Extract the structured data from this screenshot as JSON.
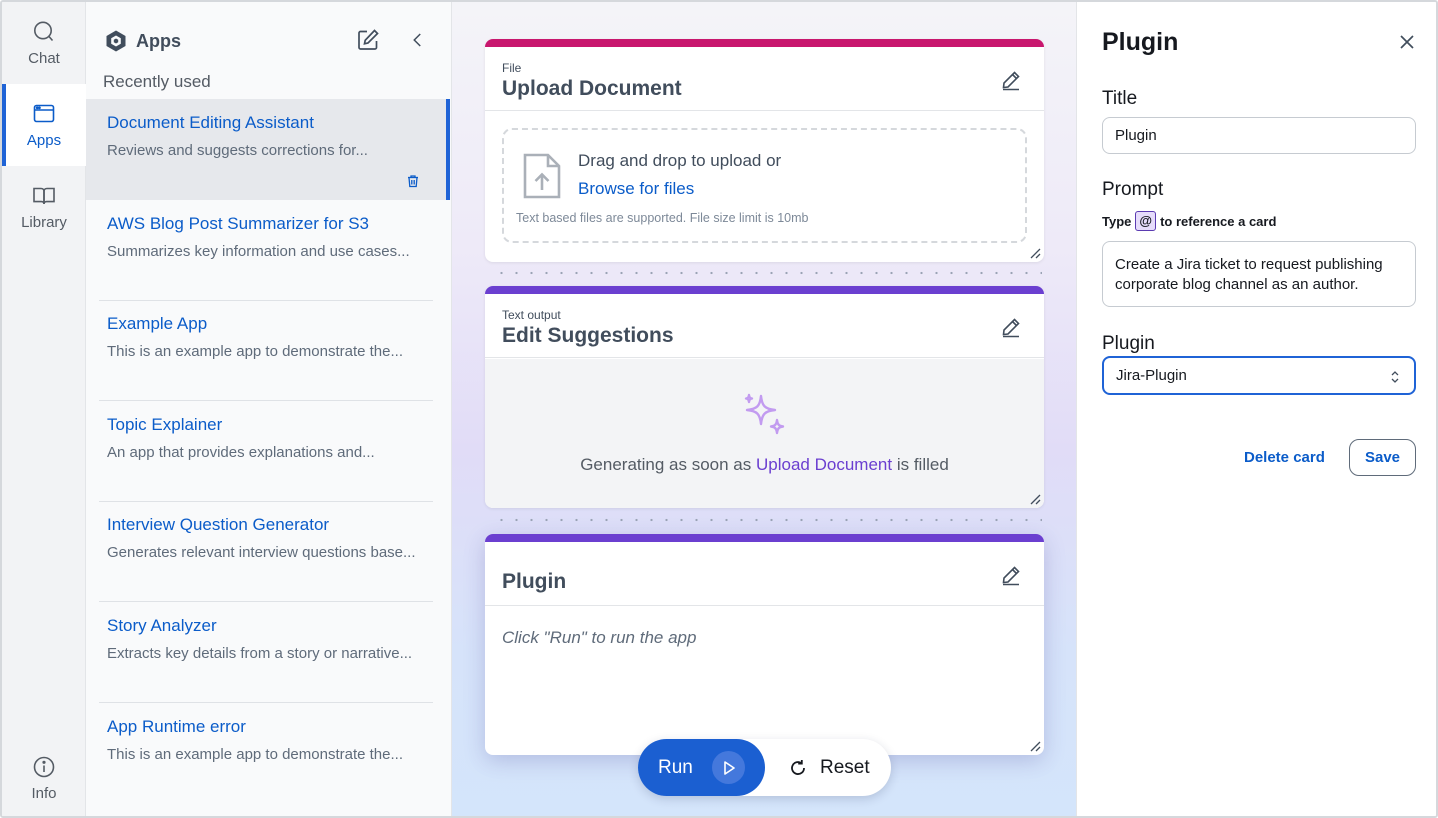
{
  "rail": {
    "items": [
      {
        "label": "Chat",
        "icon": "chat-icon"
      },
      {
        "label": "Apps",
        "icon": "apps-icon",
        "active": true
      },
      {
        "label": "Library",
        "icon": "library-icon"
      }
    ],
    "info_label": "Info"
  },
  "apps_panel": {
    "title": "Apps",
    "recent_label": "Recently used",
    "items": [
      {
        "name": "Document Editing Assistant",
        "desc": "Reviews and suggests corrections for..."
      },
      {
        "name": "AWS Blog Post Summarizer for S3",
        "desc": "Summarizes key information and use cases..."
      },
      {
        "name": "Example App",
        "desc": "This is an example app to demonstrate the..."
      },
      {
        "name": "Topic Explainer",
        "desc": "An app that provides explanations and..."
      },
      {
        "name": "Interview Question Generator",
        "desc": "Generates relevant interview questions base..."
      },
      {
        "name": "Story Analyzer",
        "desc": "Extracts key details from a story or narrative..."
      },
      {
        "name": "App Runtime error",
        "desc": "This is an example app to demonstrate the..."
      }
    ]
  },
  "cards": {
    "upload": {
      "kind": "File",
      "title": "Upload Document",
      "drag_text": "Drag and drop to upload or",
      "browse_text": "Browse for files",
      "note": "Text based files are supported. File size limit is 10mb",
      "accent": "#c8176e"
    },
    "output": {
      "kind": "Text output",
      "title": "Edit Suggestions",
      "status_prefix": "Generating as soon as",
      "status_ref": "Upload Document",
      "status_suffix": "is filled",
      "accent": "#6b3fd0"
    },
    "plugin": {
      "title": "Plugin",
      "placeholder": "Click \"Run\" to run the app",
      "accent": "#6b3fd0"
    }
  },
  "actions": {
    "run_label": "Run",
    "reset_label": "Reset"
  },
  "right_panel": {
    "title": "Plugin",
    "title_label": "Title",
    "title_value": "Plugin",
    "prompt_label": "Prompt",
    "hint_prefix": "Type",
    "hint_at": "@",
    "hint_suffix": "to reference a card",
    "prompt_value": "Create a Jira ticket to request publishing corporate blog channel as an author.",
    "plugin_label": "Plugin",
    "plugin_value": "Jira-Plugin",
    "delete_label": "Delete card",
    "save_label": "Save"
  },
  "colors": {
    "primary": "#1b5fd1",
    "link": "#0b5cc9",
    "purple": "#6b3fd0"
  }
}
